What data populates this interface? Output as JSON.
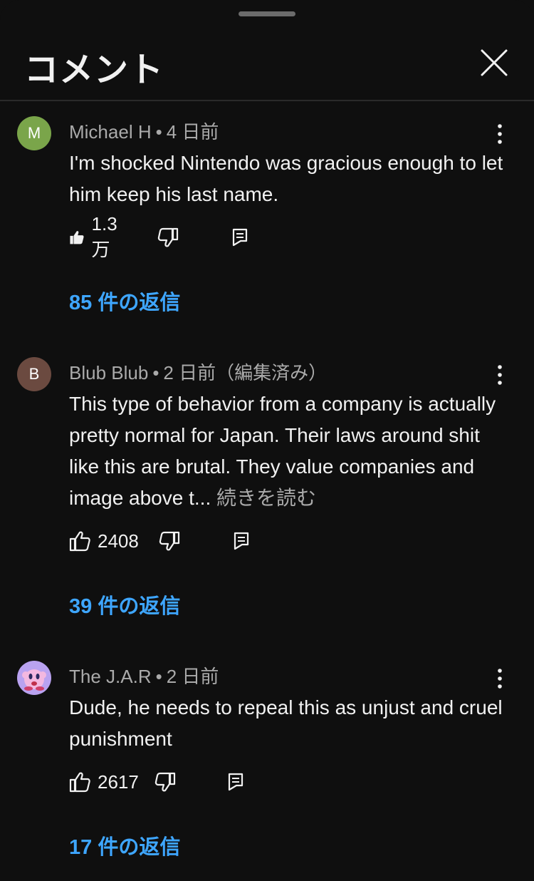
{
  "header": {
    "title": "コメント"
  },
  "comments": [
    {
      "avatar_letter": "M",
      "avatar_color": "#7aa54a",
      "author": "Michael H",
      "time": "4 日前",
      "text": "I'm shocked Nintendo was gracious enough to let him keep his last name.",
      "read_more": "",
      "likes": "1.3万",
      "liked": true,
      "replies": "85 件の返信"
    },
    {
      "avatar_letter": "B",
      "avatar_color": "#6b4a40",
      "author": "Blub Blub",
      "time": "2 日前（編集済み）",
      "text": "This type of behavior from a company is actually pretty normal for Japan. Their laws around shit like this are brutal. They value companies and image above t...",
      "read_more": "続きを読む",
      "likes": "2408",
      "liked": false,
      "replies": "39 件の返信"
    },
    {
      "avatar_letter": "",
      "avatar_color": "#b9a2f0",
      "author": "The J.A.R",
      "time": "2 日前",
      "text": "Dude, he needs to repeal this as unjust and cruel punishment",
      "read_more": "",
      "likes": "2617",
      "liked": false,
      "replies": "17 件の返信"
    }
  ],
  "colors": {
    "background": "#0f0f0f",
    "text": "#f1f1f1",
    "secondary_text": "#aaaaaa",
    "link": "#3ea6ff"
  },
  "icons": {
    "close": "close-icon",
    "more": "more-vertical-icon",
    "like": "thumbs-up-icon",
    "dislike": "thumbs-down-icon",
    "reply": "reply-icon"
  }
}
